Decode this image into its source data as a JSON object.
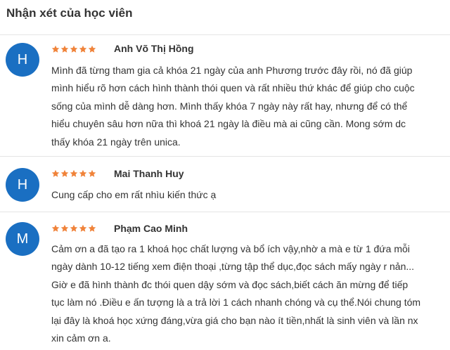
{
  "section": {
    "title": "Nhận xét của học viên"
  },
  "colors": {
    "avatar_bg": "#1a6fc2",
    "star": "#f0833a",
    "separator": "#e5e5e5"
  },
  "reviews": [
    {
      "initial": "H",
      "name": "Anh Võ Thị Hồng",
      "rating": 5,
      "comment_lines": [
        "Mình đã từng tham gia cả khóa 21 ngày của anh Phương trước đây rồi, nó đã giúp",
        "mình hiểu rõ hơn cách hình thành thói quen và rất nhiều thứ khác để giúp cho cuộc",
        "sống của mình dễ dàng hơn. Mình thấy khóa 7 ngày này rất hay, nhưng để có thể",
        "hiểu chuyên sâu hơn nữa thì khoá 21 ngày là điều mà ai cũng cần. Mong sớm dc",
        "thấy khóa 21 ngày trên unica."
      ]
    },
    {
      "initial": "H",
      "name": "Mai Thanh Huy",
      "rating": 5,
      "comment_lines": [
        "Cung cấp cho em rất nhìu kiến thức ạ"
      ]
    },
    {
      "initial": "M",
      "name": "Phạm Cao Minh",
      "rating": 5,
      "comment_lines": [
        "Cảm ơn a đã tạo ra 1 khoá học chất lượng và bổ ích vậy,nhờ a mà e từ 1 đứa mỗi",
        "ngày dành 10-12 tiếng xem điện thoại ,từng tập thể dục,đọc sách mấy ngày r nản...",
        "Giờ e đã hình thành đc thói quen dậy sớm và đọc sách,biết cách ăn mừng để tiếp",
        "tục làm nó .Điều e ấn tượng là a trả lời 1 cách nhanh chóng và cụ thể.Nói chung tóm",
        "lại đây là khoá học xứng đáng,vừa giá cho bạn nào ít tiền,nhất là sinh viên và lần nx",
        "xin cảm ơn a."
      ]
    }
  ]
}
